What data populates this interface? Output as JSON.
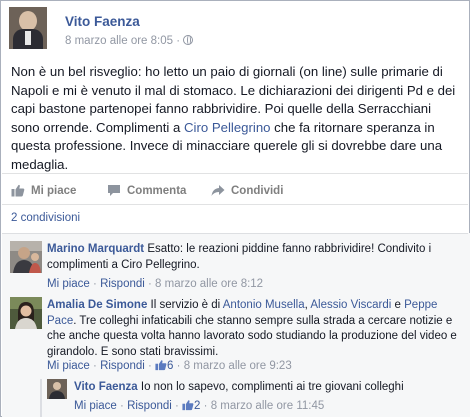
{
  "post": {
    "author": "Vito Faenza",
    "date": "8 marzo alle ore 8:05",
    "separator": "·",
    "text_parts": {
      "before_mention": "Non è un bel risveglio: ho letto un paio di giornali (on line) sulle primarie di Napoli e mi è venuto il mal di stomaco. Le dichiarazioni dei dirigenti Pd e dei capi bastone partenopei fanno rabbrividire. Poi quelle della Serracchiani sono orrende. Complimenti a ",
      "mention": "Ciro Pellegrino",
      "after_mention": " che fa ritornare speranza in questa professione. Invece di minacciare querele gli si dovrebbe dare una medaglia."
    }
  },
  "actions": {
    "like": "Mi piace",
    "comment": "Commenta",
    "share": "Condividi"
  },
  "shares_count": "2 condivisioni",
  "comments": [
    {
      "name": "Marino Marquardt",
      "text": " Esatto: le reazioni piddine fanno rabbrividire! Condivito i complimenti a Ciro Pellegrino.",
      "like": "Mi piace",
      "reply": "Rispondi",
      "date": "8 marzo alle ore 8:12"
    },
    {
      "name": "Amalia De Simone",
      "text_a": " Il servizio è di ",
      "mention_1": "Antonio Musella",
      "text_b": ", ",
      "mention_2": "Alessio Viscardi",
      "text_c": " e ",
      "mention_3": "Peppe Pace",
      "text_d": ". Tre colleghi infaticabili che stanno sempre sulla strada a cercare notizie e che anche questa volta hanno lavorato sodo studiando la produzione del video e girandolo. E sono stati bravissimi.",
      "like": "Mi piace",
      "reply": "Rispondi",
      "likes_count": "6",
      "date": "8 marzo alle ore 9:23"
    },
    {
      "name": "Vito Faenza",
      "text": " Io non lo sapevo, complimenti ai tre giovani colleghi",
      "like": "Mi piace",
      "reply": "Rispondi",
      "likes_count": "2",
      "date": "8 marzo alle ore 11:45"
    }
  ],
  "colors": {
    "link": "#3b5998",
    "meta": "#9197a3",
    "comments_bg": "#f6f7f8"
  },
  "icons": [
    "globe-icon",
    "like-icon",
    "comment-icon",
    "share-icon",
    "thumbs-up-icon"
  ]
}
